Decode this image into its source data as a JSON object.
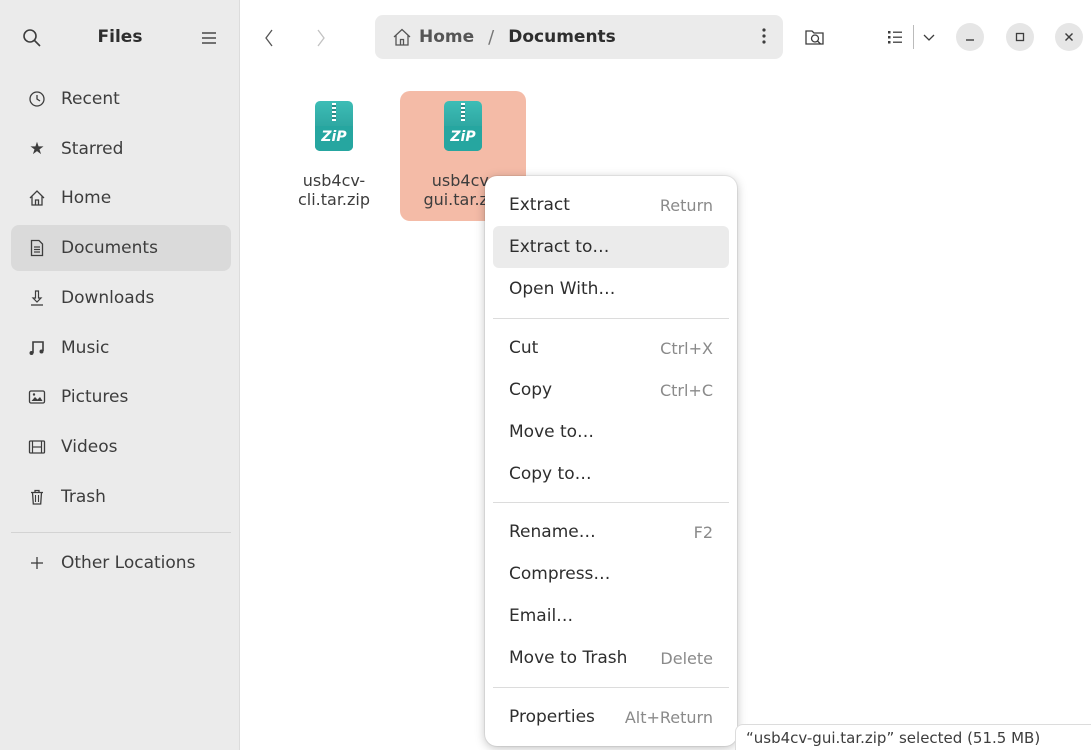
{
  "sidebar": {
    "title": "Files",
    "items": [
      {
        "label": "Recent",
        "icon": "clock-icon"
      },
      {
        "label": "Starred",
        "icon": "star-icon"
      },
      {
        "label": "Home",
        "icon": "home-icon"
      },
      {
        "label": "Documents",
        "icon": "document-icon"
      },
      {
        "label": "Downloads",
        "icon": "download-icon"
      },
      {
        "label": "Music",
        "icon": "music-icon"
      },
      {
        "label": "Pictures",
        "icon": "picture-icon"
      },
      {
        "label": "Videos",
        "icon": "film-icon"
      },
      {
        "label": "Trash",
        "icon": "trash-icon"
      }
    ],
    "other_locations": "Other Locations"
  },
  "pathbar": {
    "home": "Home",
    "separator": "/",
    "current": "Documents"
  },
  "files": [
    {
      "name": "usb4cv-\ncli.tar.zip",
      "type_label": "ZiP"
    },
    {
      "name": "usb4cv-\ngui.tar.zip",
      "type_label": "ZiP"
    }
  ],
  "context_menu": {
    "extract": {
      "label": "Extract",
      "shortcut": "Return"
    },
    "extract_to": {
      "label": "Extract to…"
    },
    "open_with": {
      "label": "Open With…"
    },
    "cut": {
      "label": "Cut",
      "shortcut": "Ctrl+X"
    },
    "copy": {
      "label": "Copy",
      "shortcut": "Ctrl+C"
    },
    "move_to": {
      "label": "Move to…"
    },
    "copy_to": {
      "label": "Copy to…"
    },
    "rename": {
      "label": "Rename…",
      "shortcut": "F2"
    },
    "compress": {
      "label": "Compress…"
    },
    "email": {
      "label": "Email…"
    },
    "move_to_trash": {
      "label": "Move to Trash",
      "shortcut": "Delete"
    },
    "properties": {
      "label": "Properties",
      "shortcut": "Alt+Return"
    }
  },
  "status": "“usb4cv-gui.tar.zip” selected  (51.5 MB)",
  "colors": {
    "selection": "#f4bba7",
    "sidebar_bg": "#ebebeb",
    "zip_icon": "#26a6a0"
  }
}
